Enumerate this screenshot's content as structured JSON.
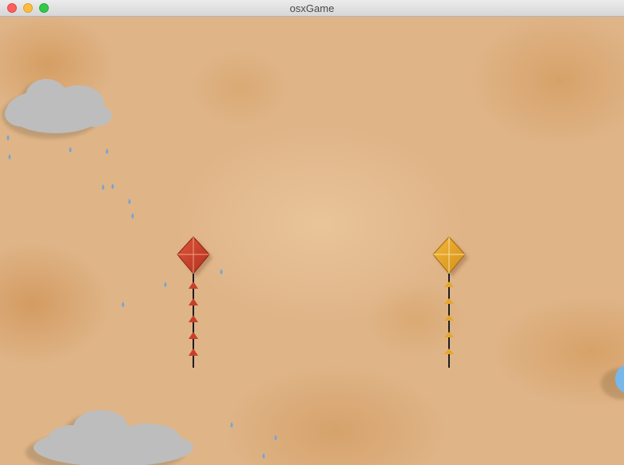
{
  "window": {
    "title": "osxGame"
  },
  "colors": {
    "kite_red": "#c8402a",
    "kite_yellow": "#e6a62a",
    "cloud": "#bcbcbc",
    "raindrop": "#6fa6d8",
    "balloon": "#78b8e8"
  },
  "icons": {
    "close": "close-icon",
    "minimize": "minimize-icon",
    "maximize": "maximize-icon"
  }
}
